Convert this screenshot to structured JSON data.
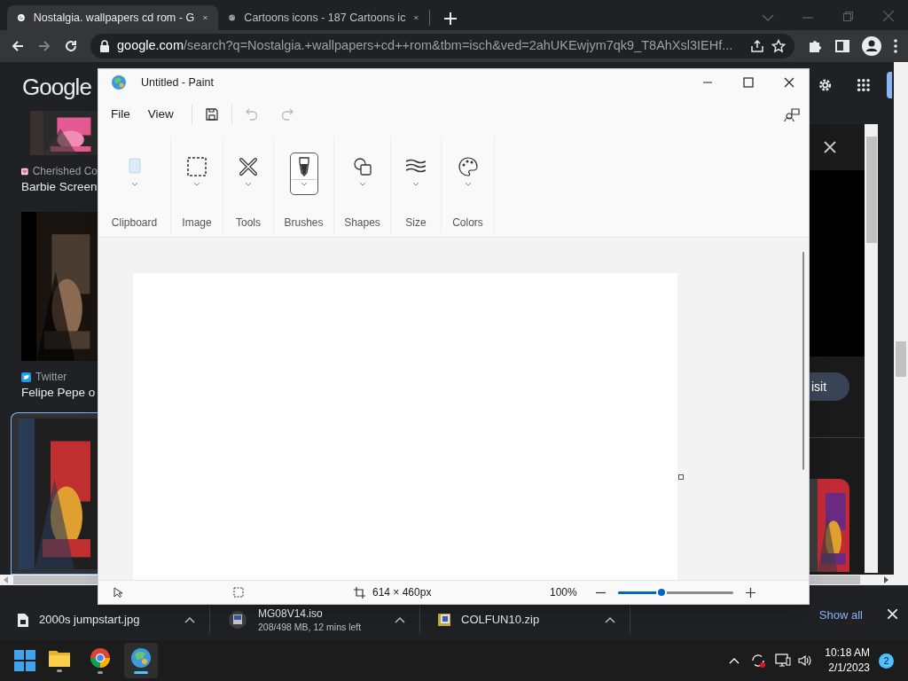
{
  "browser": {
    "tabs": [
      {
        "title": "Nostalgia. wallpapers cd rom - G",
        "selected": true
      },
      {
        "title": "Cartoons icons - 187 Cartoons ic",
        "selected": false
      }
    ],
    "address": {
      "domain": "google.com",
      "path": "/search?q=Nostalgia.+wallpapers+cd++rom&tbm=isch&ved=2ahUKEwjym7qk9_T8AhXsl3IEHf..."
    },
    "logo": "Google",
    "results": [
      {
        "source": "Cherished Co",
        "title": "Barbie Screen"
      },
      {
        "source": "Twitter",
        "title": "Felipe Pepe o"
      }
    ],
    "preview": {
      "visit_button": "isit"
    }
  },
  "paint": {
    "title": "Untitled - Paint",
    "menu": [
      "File",
      "View"
    ],
    "undo": {
      "disabled": true
    },
    "redo": {
      "disabled": true
    },
    "ribbon": [
      {
        "label": "Clipboard",
        "selected": false,
        "disabled": true
      },
      {
        "label": "Image",
        "selected": false,
        "disabled": false
      },
      {
        "label": "Tools",
        "selected": false,
        "disabled": false
      },
      {
        "label": "Brushes",
        "selected": true,
        "disabled": false
      },
      {
        "label": "Shapes",
        "selected": false,
        "disabled": false
      },
      {
        "label": "Size",
        "selected": false,
        "disabled": false
      },
      {
        "label": "Colors",
        "selected": false,
        "disabled": false
      }
    ],
    "status": {
      "canvas_size": "614 × 460px",
      "zoom": "100%"
    },
    "zoom_slider": {
      "level": 0.38
    }
  },
  "downloads": {
    "items": [
      {
        "name": "2000s jumpstart.jpg"
      },
      {
        "name": "MG08V14.iso",
        "progress": "208/498 MB, 12 mins left"
      },
      {
        "name": "COLFUN10.zip"
      }
    ],
    "show_all": "Show all"
  },
  "taskbar": {
    "apps": [
      {
        "kind": "explorer",
        "selected": false
      },
      {
        "kind": "chrome",
        "selected": false
      },
      {
        "kind": "paint",
        "selected": true
      }
    ],
    "time": "10:18 AM",
    "date": "2/1/2023",
    "notifications": "2"
  }
}
